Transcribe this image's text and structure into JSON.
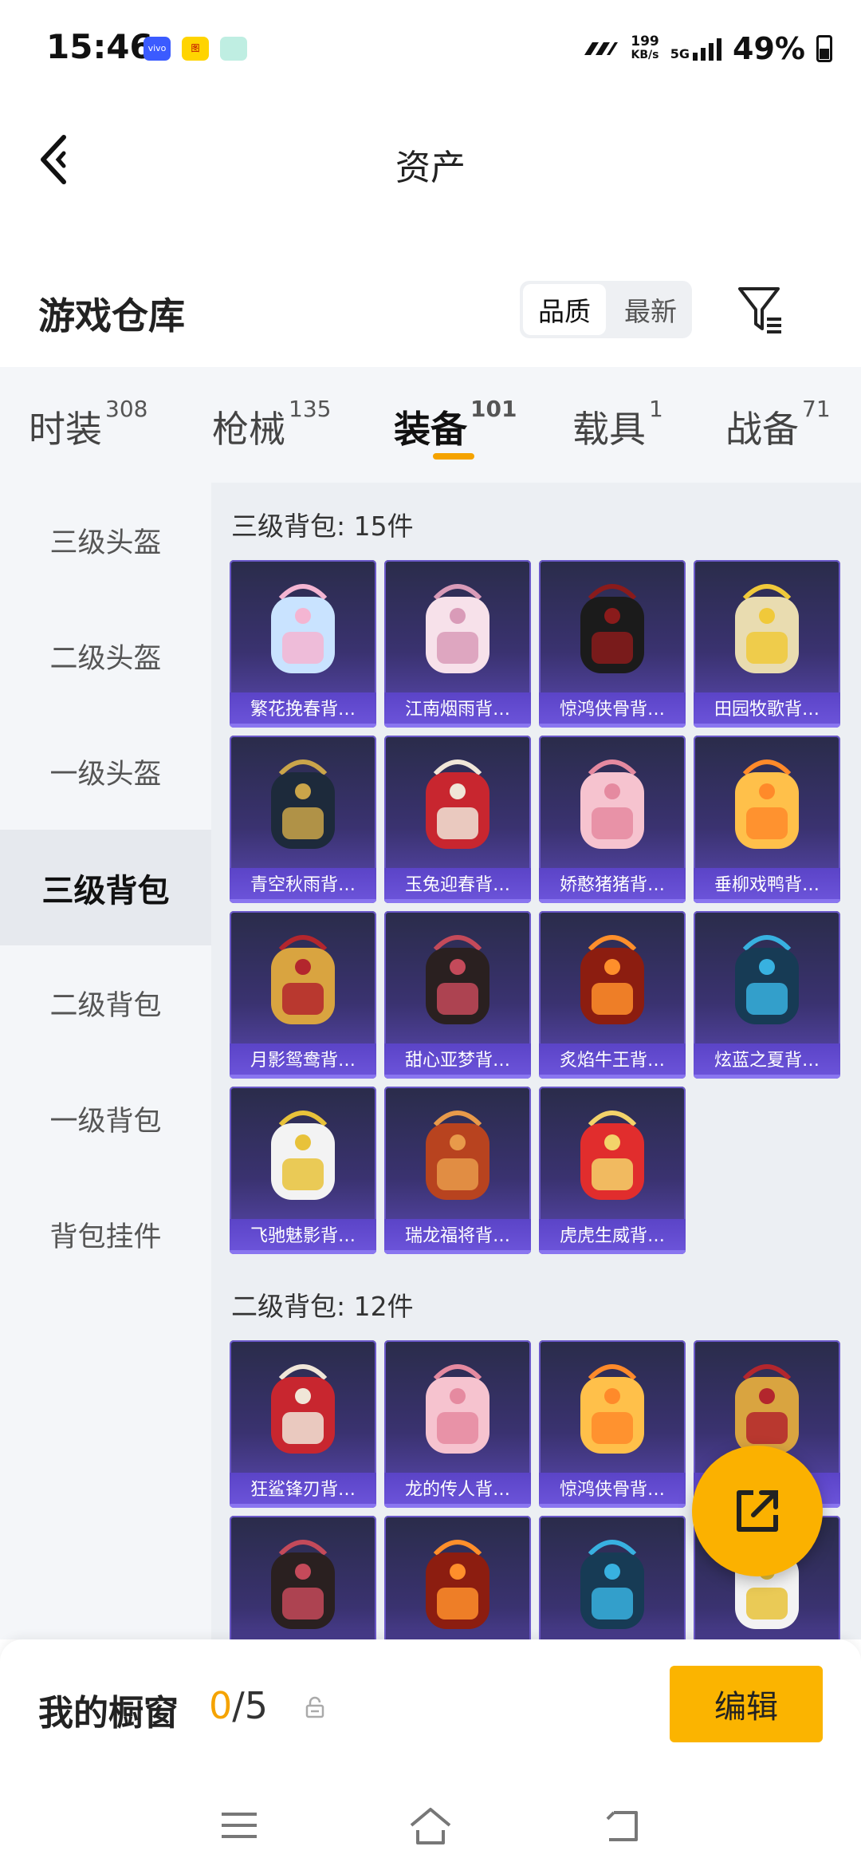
{
  "status": {
    "time": "15:46",
    "speed_value": "199",
    "speed_unit": "KB/s",
    "network": "5G",
    "battery": "49%"
  },
  "nav": {
    "title": "资产"
  },
  "warehouse": {
    "title": "游戏仓库",
    "sort_quality": "品质",
    "sort_latest": "最新"
  },
  "tabs": [
    {
      "label": "时装",
      "count": "308"
    },
    {
      "label": "枪械",
      "count": "135"
    },
    {
      "label": "装备",
      "count": "101"
    },
    {
      "label": "载具",
      "count": "1"
    },
    {
      "label": "战备",
      "count": "71"
    }
  ],
  "sidebar": [
    {
      "label": "三级头盔"
    },
    {
      "label": "二级头盔"
    },
    {
      "label": "一级头盔"
    },
    {
      "label": "三级背包"
    },
    {
      "label": "二级背包"
    },
    {
      "label": "一级背包"
    },
    {
      "label": "背包挂件"
    }
  ],
  "sections": [
    {
      "title": "三级背包: 15件",
      "items": [
        "繁花挽春背…",
        "江南烟雨背…",
        "惊鸿侠骨背…",
        "田园牧歌背…",
        "青空秋雨背…",
        "玉兔迎春背…",
        "娇憨猪猪背…",
        "垂柳戏鸭背…",
        "月影鸳鸯背…",
        "甜心亚梦背…",
        "炙焰牛王背…",
        "炫蓝之夏背…",
        "飞驰魅影背…",
        "瑞龙福将背…",
        "虎虎生威背…"
      ]
    },
    {
      "title": "二级背包: 12件",
      "items": [
        "狂鲨锋刃背…",
        "龙的传人背…",
        "惊鸿侠骨背…",
        "",
        "",
        "",
        "",
        ""
      ]
    }
  ],
  "showcase": {
    "label": "我的橱窗",
    "current": "0",
    "separator_total": "/5",
    "edit": "编辑"
  },
  "colors": {
    "accent": "#f5a300",
    "card_top": "#2a2c4a",
    "card_bottom": "#5c4ab5"
  }
}
